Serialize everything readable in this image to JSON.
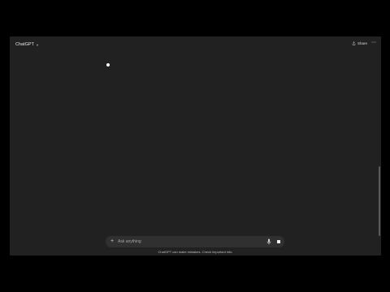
{
  "header": {
    "model_name": "ChatGPT",
    "model_chevron_icon": "chevron-down-icon",
    "share_label": "Share",
    "share_icon": "share-icon",
    "more_icon": "more-horizontal-icon",
    "more_glyph": "⋯"
  },
  "composer": {
    "placeholder": "Ask anything",
    "value": "",
    "attach_icon": "plus-icon",
    "attach_glyph": "+",
    "mic_icon": "microphone-icon",
    "stop_icon": "stop-icon"
  },
  "footer": {
    "disclaimer": "ChatGPT can make mistakes. Check important info."
  },
  "colors": {
    "background": "#000000",
    "window": "#212121",
    "composer": "#303030",
    "text": "#ececec"
  }
}
